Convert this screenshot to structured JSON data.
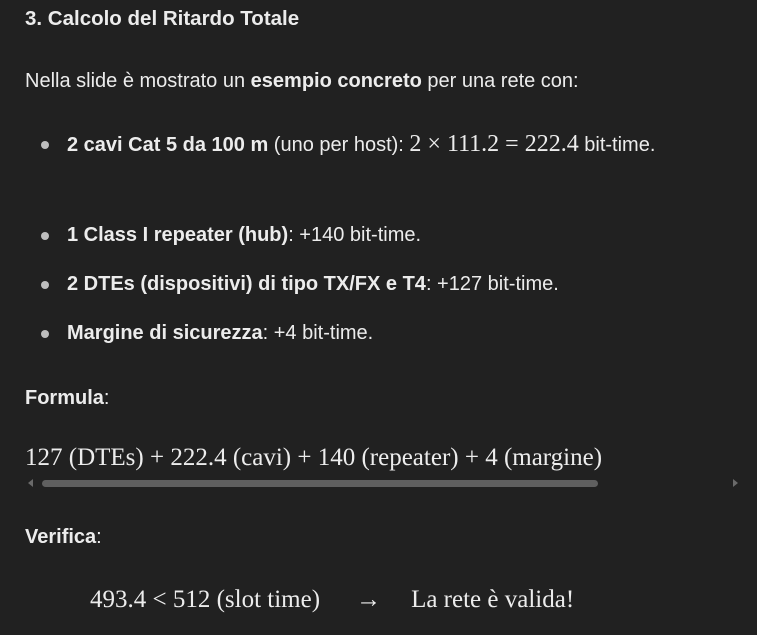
{
  "section": {
    "heading": "3. Calcolo del Ritardo Totale",
    "intro": {
      "prefix": "Nella slide è mostrato un ",
      "bold": "esempio concreto",
      "suffix": " per una rete con:"
    },
    "items": [
      {
        "bold": "2 cavi Cat 5 da 100 m",
        "rest": " (uno per host): ",
        "math": "2 × 111.2 = 222.4",
        "after": " bit-time."
      },
      {
        "bold": "1 Class I repeater (hub)",
        "rest": ": +140 bit-time."
      },
      {
        "bold": "2 DTEs (dispositivi) di tipo TX/FX e T4",
        "rest": ": +127 bit-time."
      },
      {
        "bold": "Margine di sicurezza",
        "rest": ": +4 bit-time."
      }
    ],
    "formula_label": "Formula",
    "formula": "127 (DTEs) + 222.4 (cavi) + 140 (repeater) + 4 (margine)",
    "verify_label": "Verifica",
    "verify": {
      "expr": "493.4 < 512 (slot time)",
      "arrow": "→",
      "result": "La rete è valida!"
    },
    "colon": ":"
  },
  "colors": {
    "background": "#212121",
    "text": "#ececec",
    "bullet": "#bdbdbd",
    "scrollbar": "#5f5f5f"
  }
}
